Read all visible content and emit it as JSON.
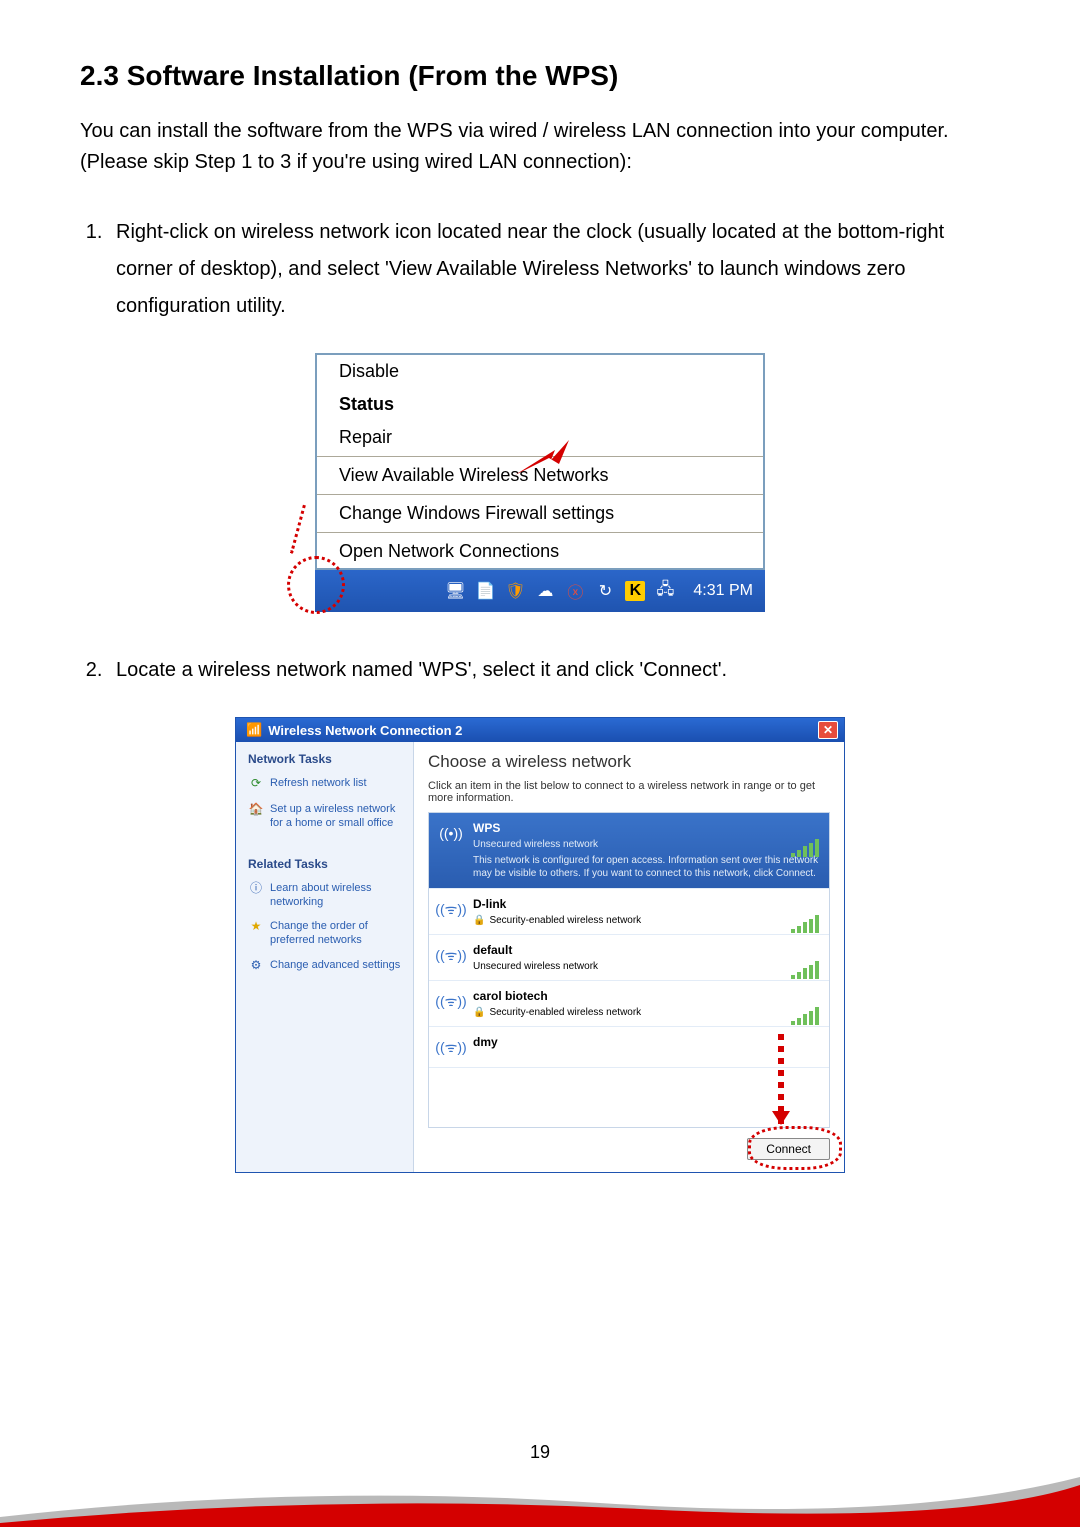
{
  "section": {
    "number": "2.3",
    "title": "Software Installation (From the WPS)",
    "intro": "You can install the software from the WPS via wired / wireless LAN connection into your computer. (Please skip Step 1 to 3 if you're using wired LAN connection):",
    "step1": "Right-click on wireless network icon located near the clock (usually located at the bottom-right corner of desktop), and select 'View Available Wireless Networks' to launch windows zero configuration utility.",
    "step2": "Locate a wireless network named 'WPS', select it and click 'Connect'."
  },
  "context_menu": {
    "disable": "Disable",
    "status": "Status",
    "repair": "Repair",
    "view": "View Available Wireless Networks",
    "firewall": "Change Windows Firewall settings",
    "open_conn": "Open Network Connections",
    "clock": "4:31 PM"
  },
  "wireless_window": {
    "title": "Wireless Network Connection 2",
    "sidebar": {
      "network_tasks": "Network Tasks",
      "refresh": "Refresh network list",
      "setup": "Set up a wireless network for a home or small office",
      "related_tasks": "Related Tasks",
      "learn": "Learn about wireless networking",
      "change_order": "Change the order of preferred networks",
      "change_adv": "Change advanced settings"
    },
    "main": {
      "heading": "Choose a wireless network",
      "sub": "Click an item in the list below to connect to a wireless network in range or to get more information.",
      "unsecured": "Unsecured wireless network",
      "secured": "Security-enabled wireless network",
      "warn": "This network is configured for open access. Information sent over this network may be visible to others. If you want to connect to this network, click Connect.",
      "net1": "WPS",
      "net2": "D-link",
      "net3": "default",
      "net4": "carol biotech",
      "net5": "dmy",
      "connect": "Connect"
    }
  },
  "page_number": "19"
}
